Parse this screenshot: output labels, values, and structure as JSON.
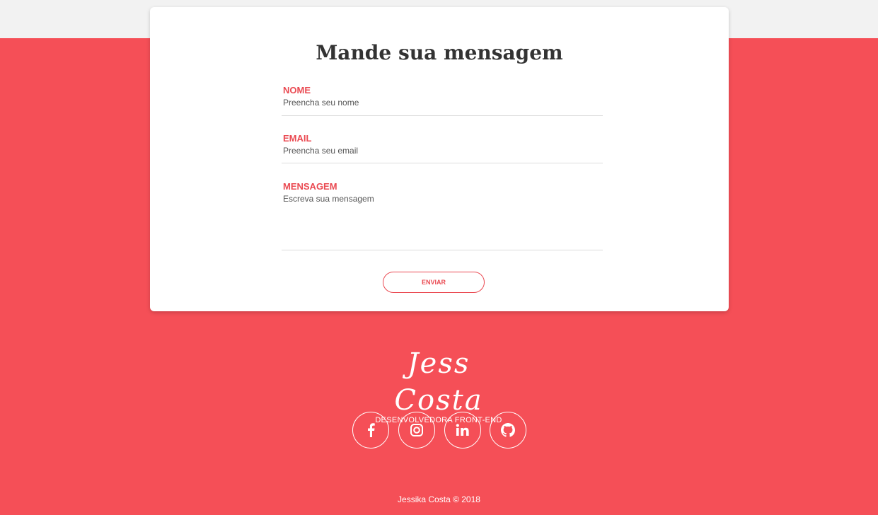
{
  "form": {
    "title": "Mande sua mensagem",
    "fields": [
      {
        "label": "NOME",
        "placeholder": "Preencha seu nome"
      },
      {
        "label": "EMAIL",
        "placeholder": "Preencha seu email"
      },
      {
        "label": "MENSAGEM",
        "placeholder": "Escreva sua mensagem"
      }
    ],
    "submit_label": "ENVIAR"
  },
  "footer": {
    "logo_name": "Jess Costa",
    "logo_subtitle": "DESENVOLVEDORA FRONT-END",
    "social_icons": [
      "facebook-icon",
      "instagram-icon",
      "linkedin-icon",
      "github-icon"
    ],
    "copyright": "Jessika Costa  ©  2018"
  },
  "colors": {
    "accent": "#ea4a52",
    "background": "#f54f57",
    "top_band": "#f2f2f2",
    "card": "#ffffff",
    "title": "#333333"
  }
}
